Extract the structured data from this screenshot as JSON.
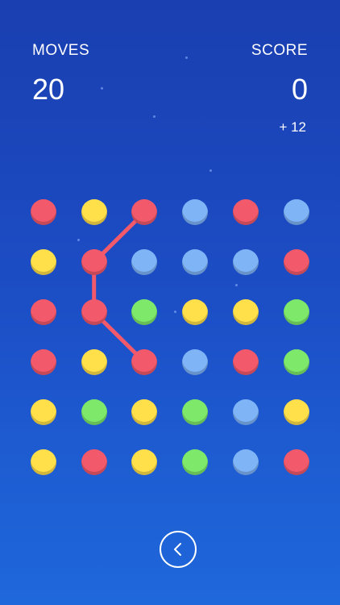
{
  "hud": {
    "moves_label": "MOVES",
    "moves_value": "20",
    "score_label": "SCORE",
    "score_value": "0",
    "bonus": "+ 12"
  },
  "colors": {
    "red": "#f25a6b",
    "yellow": "#ffe04a",
    "blue": "#7fb4f7",
    "green": "#7ee86b",
    "line": "#f25a6b"
  },
  "board": {
    "rows": 6,
    "cols": 6,
    "grid": [
      [
        "red",
        "yellow",
        "red",
        "blue",
        "red",
        "blue"
      ],
      [
        "yellow",
        "red",
        "blue",
        "blue",
        "blue",
        "red"
      ],
      [
        "red",
        "red",
        "green",
        "yellow",
        "yellow",
        "green"
      ],
      [
        "red",
        "yellow",
        "red",
        "blue",
        "red",
        "green"
      ],
      [
        "yellow",
        "green",
        "yellow",
        "green",
        "blue",
        "yellow"
      ],
      [
        "yellow",
        "red",
        "yellow",
        "green",
        "blue",
        "red"
      ]
    ],
    "selected_path": [
      [
        0,
        2
      ],
      [
        1,
        1
      ],
      [
        2,
        1
      ],
      [
        3,
        2
      ]
    ]
  },
  "controls": {
    "back_icon": "chevron-left-icon"
  }
}
